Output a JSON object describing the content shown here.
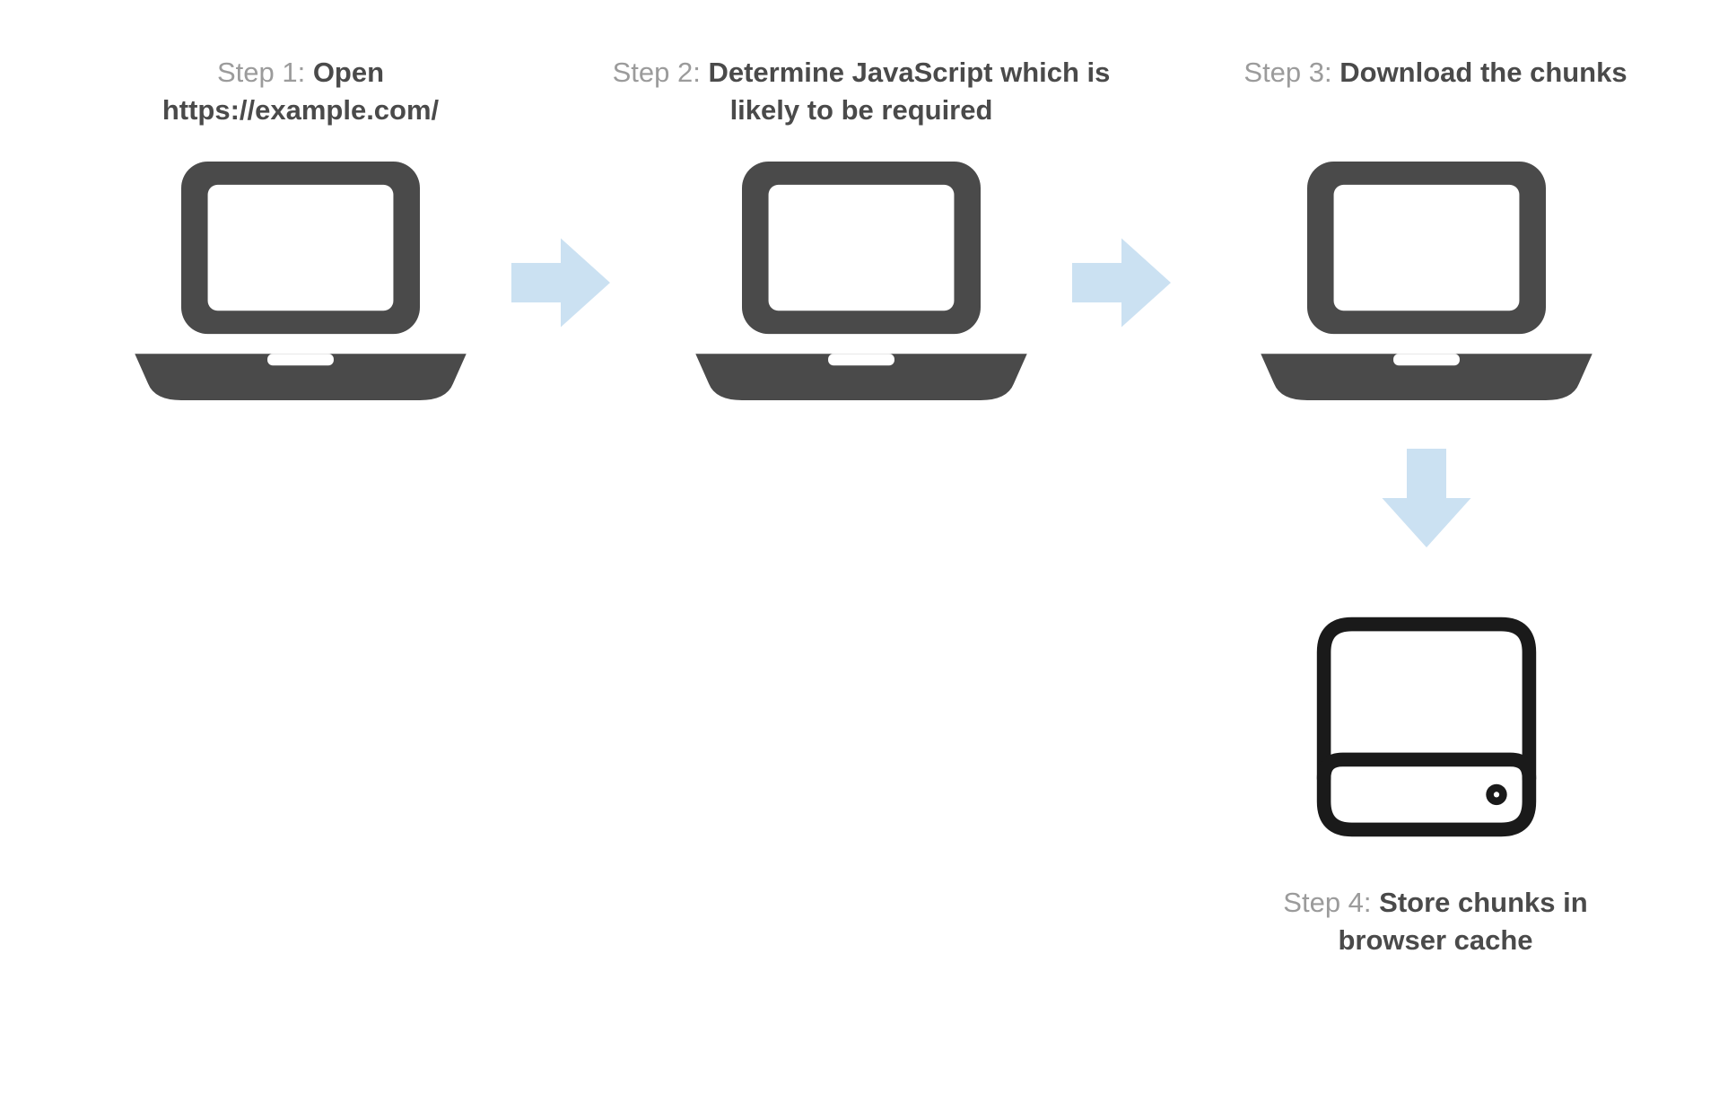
{
  "colors": {
    "laptop": "#4a4a4a",
    "drive": "#1a1a1a",
    "arrow": "#cbe1f2",
    "prefix": "#9b9b9b",
    "bold": "#4a4a4a"
  },
  "steps": {
    "s1": {
      "prefix": "Step 1: ",
      "bold": "Open https://example.com/"
    },
    "s2": {
      "prefix": "Step 2: ",
      "bold": "Determine JavaScript which is likely to be required"
    },
    "s3": {
      "prefix": "Step 3: ",
      "bold": "Download the chunks"
    },
    "s4": {
      "prefix": "Step 4: ",
      "bold": "Store chunks in browser cache"
    }
  }
}
